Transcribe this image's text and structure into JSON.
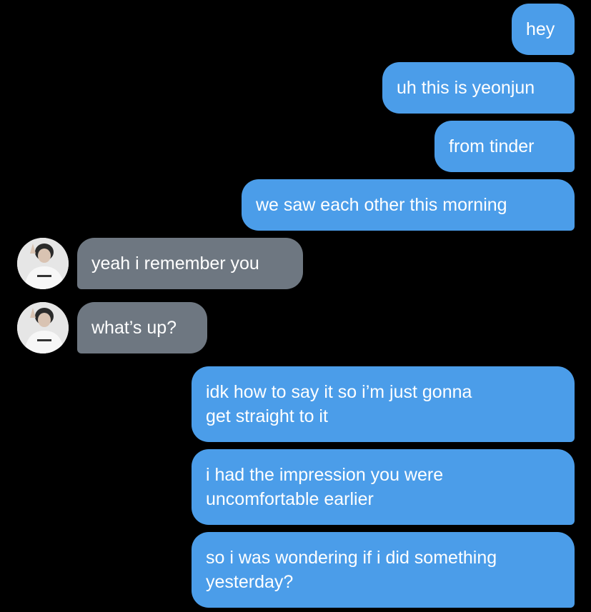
{
  "colors": {
    "background": "#000000",
    "sent_bubble": "#4b9de9",
    "received_bubble": "#6e7781",
    "text": "#ffffff"
  },
  "messages": [
    {
      "sender": "me",
      "text": "hey"
    },
    {
      "sender": "me",
      "text": "uh this is yeonjun"
    },
    {
      "sender": "me",
      "text": "from tinder"
    },
    {
      "sender": "me",
      "text": "we saw each other this morning"
    },
    {
      "sender": "them",
      "text": "yeah i remember you"
    },
    {
      "sender": "them",
      "text": "what’s up?"
    },
    {
      "sender": "me",
      "lines": [
        "idk how to say it so i’m just gonna",
        "get straight to it"
      ]
    },
    {
      "sender": "me",
      "lines": [
        "i had the impression you were",
        "uncomfortable earlier"
      ]
    },
    {
      "sender": "me",
      "lines": [
        "so i was wondering if i did something",
        "yesterday?"
      ]
    }
  ],
  "avatar": {
    "icon": "contact-avatar-icon"
  }
}
